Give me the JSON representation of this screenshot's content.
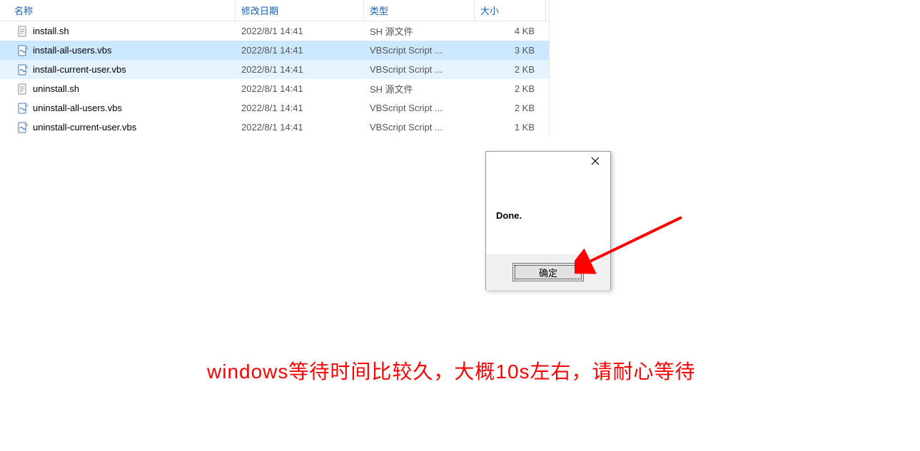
{
  "columns": {
    "name": "名称",
    "date": "修改日期",
    "type": "类型",
    "size": "大小"
  },
  "files": [
    {
      "icon": "sh",
      "name": "install.sh",
      "date": "2022/8/1 14:41",
      "type": "SH 源文件",
      "size": "4 KB",
      "state": ""
    },
    {
      "icon": "vbs",
      "name": "install-all-users.vbs",
      "date": "2022/8/1 14:41",
      "type": "VBScript Script ...",
      "size": "3 KB",
      "state": "selected"
    },
    {
      "icon": "vbs",
      "name": "install-current-user.vbs",
      "date": "2022/8/1 14:41",
      "type": "VBScript Script ...",
      "size": "2 KB",
      "state": "hover"
    },
    {
      "icon": "sh",
      "name": "uninstall.sh",
      "date": "2022/8/1 14:41",
      "type": "SH 源文件",
      "size": "2 KB",
      "state": ""
    },
    {
      "icon": "vbs",
      "name": "uninstall-all-users.vbs",
      "date": "2022/8/1 14:41",
      "type": "VBScript Script ...",
      "size": "2 KB",
      "state": ""
    },
    {
      "icon": "vbs",
      "name": "uninstall-current-user.vbs",
      "date": "2022/8/1 14:41",
      "type": "VBScript Script ...",
      "size": "1 KB",
      "state": ""
    }
  ],
  "dialog": {
    "message": "Done.",
    "ok_label": "确定"
  },
  "caption": "windows等待时间比较久，大概10s左右，请耐心等待"
}
